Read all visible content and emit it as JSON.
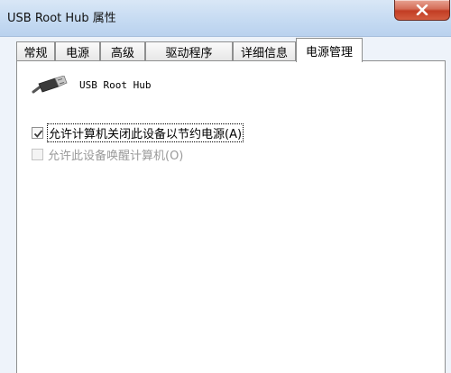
{
  "window": {
    "title": "USB Root Hub 属性",
    "close_icon": "close-icon"
  },
  "tabs": [
    {
      "label": "常规"
    },
    {
      "label": "电源"
    },
    {
      "label": "高级"
    },
    {
      "label": "驱动程序"
    },
    {
      "label": "详细信息"
    },
    {
      "label": "电源管理",
      "active": true
    }
  ],
  "panel": {
    "device_icon": "usb-plug-icon",
    "device_name": "USB Root Hub",
    "options": [
      {
        "label": "允许计算机关闭此设备以节约电源(A)",
        "checked": true,
        "enabled": true
      },
      {
        "label": "允许此设备唤醒计算机(O)",
        "checked": false,
        "enabled": false
      }
    ]
  },
  "colors": {
    "close_button": "#c23d24",
    "disabled_text": "#9a9a9a"
  }
}
